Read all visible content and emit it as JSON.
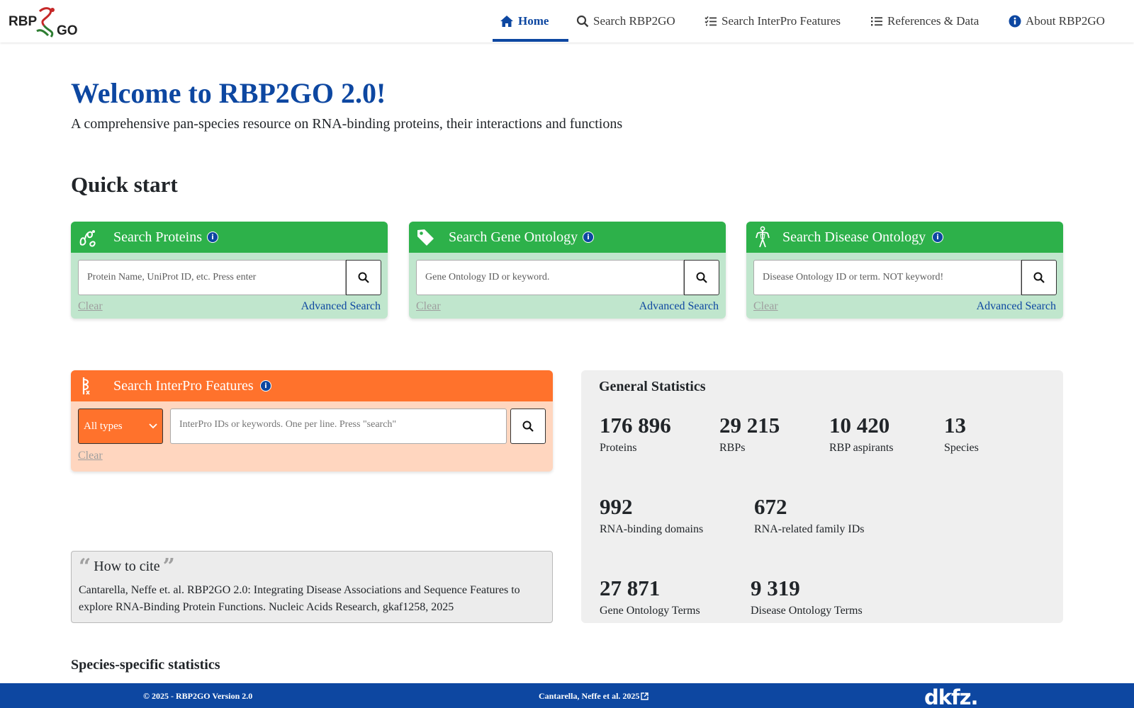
{
  "logo": {
    "text": "RBP2GO"
  },
  "nav": {
    "items": [
      {
        "label": "Home",
        "icon": "home-icon",
        "active": true
      },
      {
        "label": "Search RBP2GO",
        "icon": "search-icon"
      },
      {
        "label": "Search InterPro Features",
        "icon": "list-check-icon"
      },
      {
        "label": "References & Data",
        "icon": "list-icon"
      },
      {
        "label": "About RBP2GO",
        "icon": "info-circle-icon"
      }
    ]
  },
  "hero": {
    "title": "Welcome to RBP2GO 2.0!",
    "subtitle": "A comprehensive pan-species resource on RNA-binding proteins, their interactions and functions"
  },
  "quick_start": {
    "title": "Quick start"
  },
  "cards": [
    {
      "title": "Search Proteins",
      "placeholder": "Protein Name, UniProt ID, etc. Press enter",
      "clear": "Clear",
      "advanced": "Advanced Search",
      "icon": "protein-icon"
    },
    {
      "title": "Search Gene Ontology",
      "placeholder": "Gene Ontology ID or keyword.",
      "clear": "Clear",
      "advanced": "Advanced Search",
      "icon": "tag-icon"
    },
    {
      "title": "Search Disease Ontology",
      "placeholder": "Disease Ontology ID or term. NOT keyword!",
      "clear": "Clear",
      "advanced": "Advanced Search",
      "icon": "human-body-icon"
    }
  ],
  "interpro": {
    "title": "Search InterPro Features",
    "select_value": "All types",
    "placeholder": "InterPro IDs or keywords. One per line. Press \"search\"",
    "clear": "Clear",
    "color": "#ff722c"
  },
  "cite": {
    "title": "How to cite",
    "text": "Cantarella, Neffe et. al. RBP2GO 2.0: Integrating Disease Associations and Sequence Features to explore RNA-Binding Protein Functions. Nucleic Acids Research, gkaf1258, 2025"
  },
  "stats": {
    "title": "General Statistics",
    "items": [
      {
        "value": "176 896",
        "label": "Proteins"
      },
      {
        "value": "29 215",
        "label": "RBPs"
      },
      {
        "value": "10 420",
        "label": "RBP aspirants"
      },
      {
        "value": "13",
        "label": "Species"
      },
      {
        "value": "992",
        "label": "RNA-binding domains"
      },
      {
        "value": "672",
        "label": "RNA-related family IDs"
      },
      {
        "value": "27 871",
        "label": "Gene Ontology Terms"
      },
      {
        "value": "9 319",
        "label": "Disease Ontology Terms"
      }
    ]
  },
  "species": {
    "title": "Species-specific statistics"
  },
  "footer": {
    "left": "© 2025 - RBP2GO Version 2.0",
    "center": "Cantarella, Neffe et al. 2025",
    "right": "dkfz."
  },
  "colors": {
    "brand_blue": "#0d47a1",
    "green": "#2db14a",
    "green_light": "#c0e6cd",
    "orange": "#ff722c",
    "orange_light": "#ffd6bf"
  }
}
